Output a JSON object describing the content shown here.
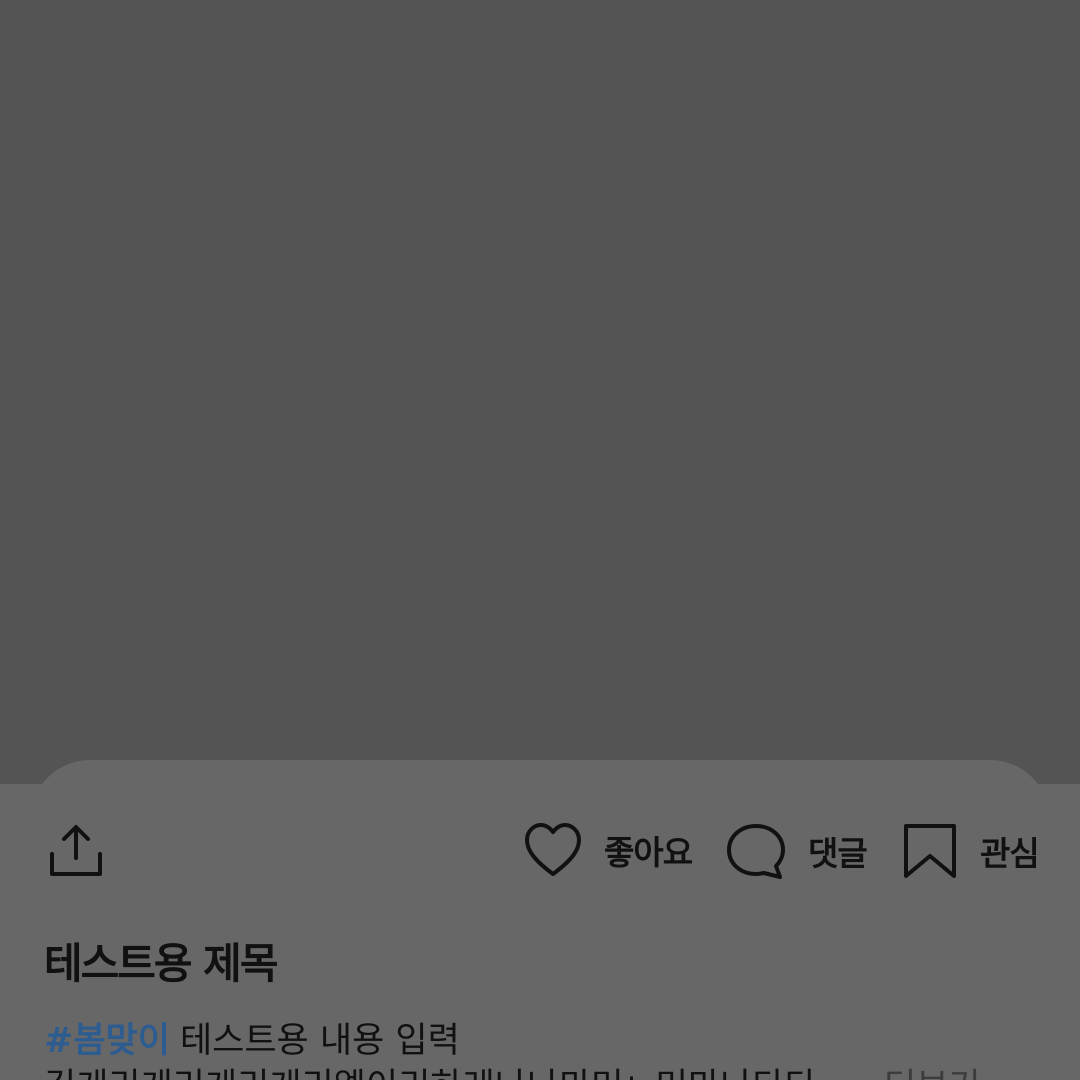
{
  "post": {
    "title": "테스트용 제목",
    "hashtag": "#봄맞이",
    "content_line1": "테스트용 내용 입력",
    "content_line2": "김게리게리게리게리엘이리하레나나마머ㄴ머마나다다",
    "more_label": "더보기"
  },
  "actions": {
    "share_icon": "share-icon",
    "like_label": "좋아요",
    "like_icon": "heart-icon",
    "comment_label": "댓글",
    "comment_icon": "speech-bubble-icon",
    "save_label": "관심",
    "save_icon": "bookmark-icon"
  },
  "colors": {
    "background": "#545454",
    "sheet": "#676767",
    "hashtag": "#2d5c91",
    "text": "#111111"
  }
}
